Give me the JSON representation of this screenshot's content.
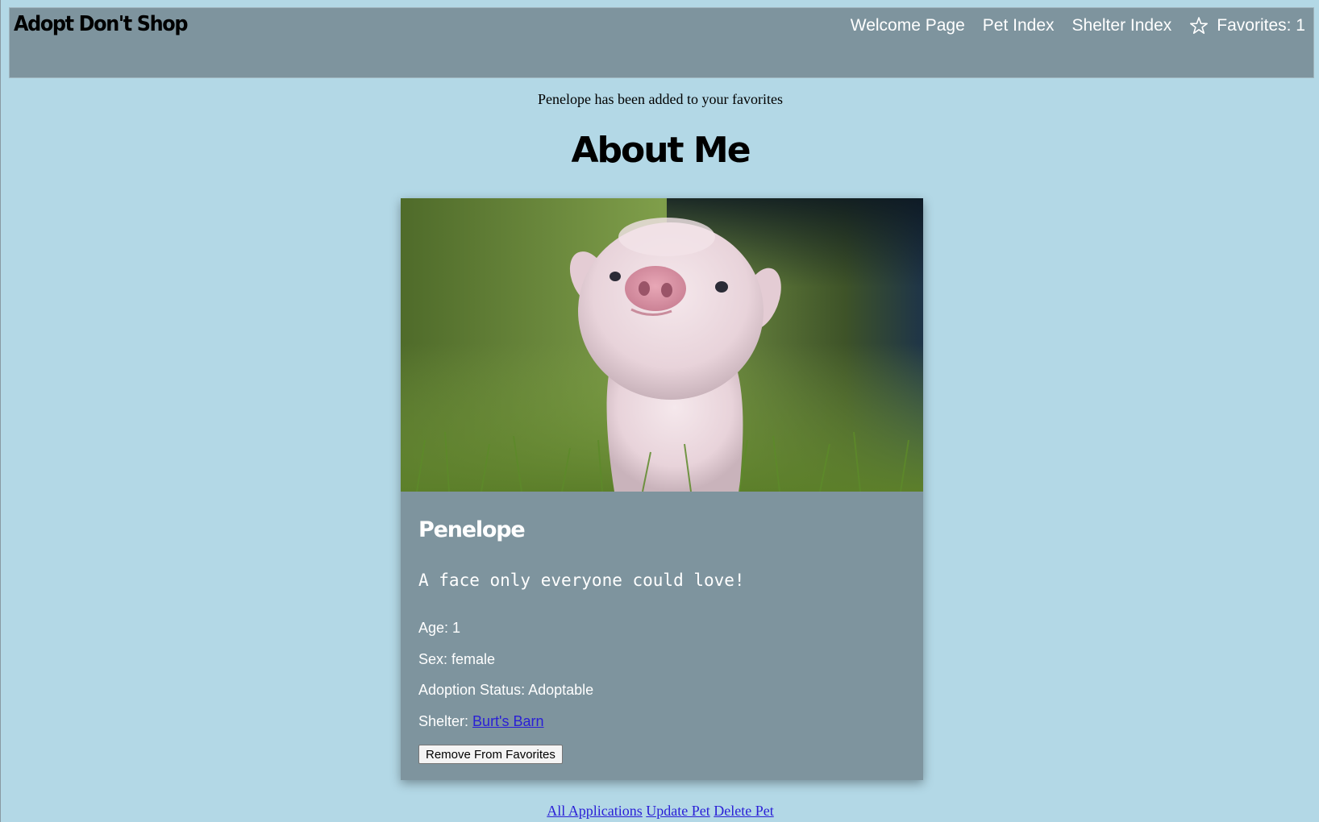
{
  "navbar": {
    "brand": "Adopt Don't Shop",
    "links": [
      "Welcome Page",
      "Pet Index",
      "Shelter Index"
    ],
    "favorites_label": "Favorites: 1",
    "favorites_icon": "star-icon"
  },
  "flash_message": "Penelope has been added to your favorites",
  "page_title": "About Me",
  "pet": {
    "photo_icon": "pet-photo",
    "name": "Penelope",
    "description": "A face only everyone could love!",
    "age": "Age: 1",
    "sex": "Sex: female",
    "adoption_status": "Adoption Status: Adoptable",
    "shelter_label": "Shelter: ",
    "shelter_name": "Burt's Barn",
    "remove_button": "Remove From Favorites"
  },
  "footer_links": [
    "All Applications",
    "Update Pet",
    "Delete Pet"
  ],
  "colors": {
    "page_background": "#b3d8e6",
    "navbar_background": "#7e949e",
    "card_background": "#7e949e",
    "link": "#2a1fd6"
  }
}
